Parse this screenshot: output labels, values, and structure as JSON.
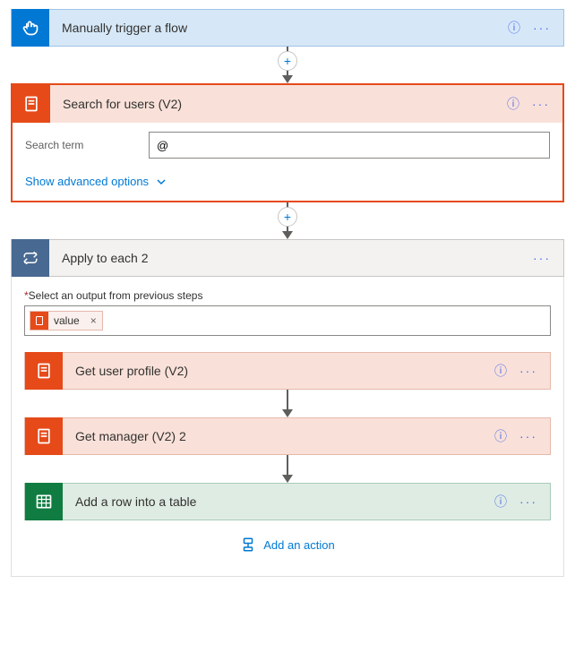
{
  "trigger": {
    "title": "Manually trigger a flow"
  },
  "search_users": {
    "title": "Search for users (V2)",
    "field_label": "Search term",
    "field_value": "@",
    "advanced_link": "Show advanced options"
  },
  "loop": {
    "title": "Apply to each 2",
    "select_label": "Select an output from previous steps",
    "token_label": "value",
    "steps": {
      "get_profile": "Get user profile (V2)",
      "get_manager": "Get manager (V2) 2",
      "add_row": "Add a row into a table"
    },
    "add_action": "Add an action"
  }
}
